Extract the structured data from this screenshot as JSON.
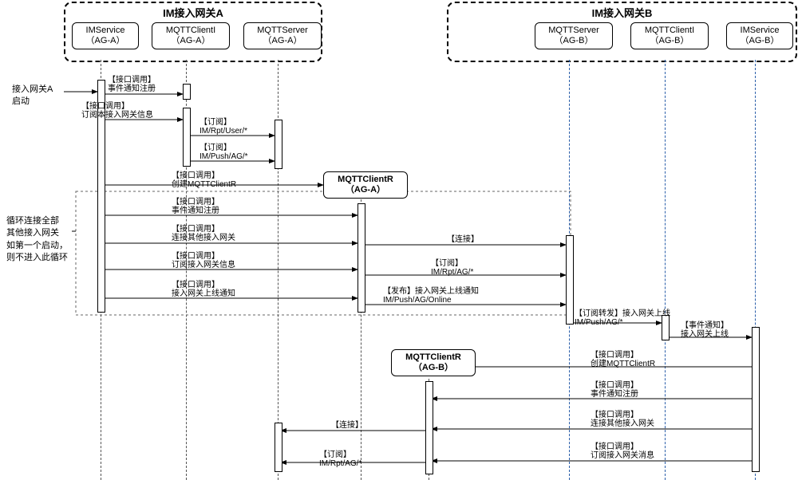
{
  "groups": {
    "A": {
      "label": "IM接入网关A"
    },
    "B": {
      "label": "IM接入网关B"
    }
  },
  "lifelines": {
    "imsA": {
      "line1": "IMService",
      "line2": "（AG-A）"
    },
    "cliIA": {
      "line1": "MQTTClientI",
      "line2": "（AG-A）"
    },
    "srvA": {
      "line1": "MQTTServer",
      "line2": "（AG-A）"
    },
    "cliRA": {
      "line1": "MQTTClientR",
      "line2": "（AG-A）"
    },
    "srvB": {
      "line1": "MQTTServer",
      "line2": "（AG-B）"
    },
    "cliIB": {
      "line1": "MQTTClientI",
      "line2": "（AG-B）"
    },
    "imsB": {
      "line1": "IMService",
      "line2": "（AG-B）"
    },
    "cliRB": {
      "line1": "MQTTClientR",
      "line2": "（AG-B）"
    }
  },
  "notes": {
    "n1": "接入网关A\n启动",
    "n2": "循环连接全部\n其他接入网关\n如第一个启动，\n则不进入此循环"
  },
  "messages": {
    "m1": "【接口调用】\n事件通知注册",
    "m2": "【接口调用】\n订阅本接入网关信息",
    "m3": "【订阅】\nIM/Rpt/User/*",
    "m4": "【订阅】\nIM/Push/AG/*",
    "m5": "【接口调用】\n创建MQTTClientR",
    "m6": "【接口调用】\n事件通知注册",
    "m7": "【接口调用】\n连接其他接入网关",
    "m8": "【连接】",
    "m9": "【接口调用】\n订阅接入网关信息",
    "m10": "【订阅】\nIM/Rpt/AG/*",
    "m11": "【接口调用】\n接入网关上线通知",
    "m12": "【发布】接入网关上线通知\nIM/Push/AG/Online",
    "m13": "【订阅转发】接入网关上线\nIM/Push/AG/*",
    "m14": "【事件通知】\n接入网关上线",
    "m15": "【接口调用】\n创建MQTTClientR",
    "m16": "【接口调用】\n事件通知注册",
    "m17": "【接口调用】\n连接其他接入网关",
    "m18": "【连接】",
    "m19": "【接口调用】\n订阅接入网关消息",
    "m20": "【订阅】\nIM/Rpt/AG/*"
  }
}
